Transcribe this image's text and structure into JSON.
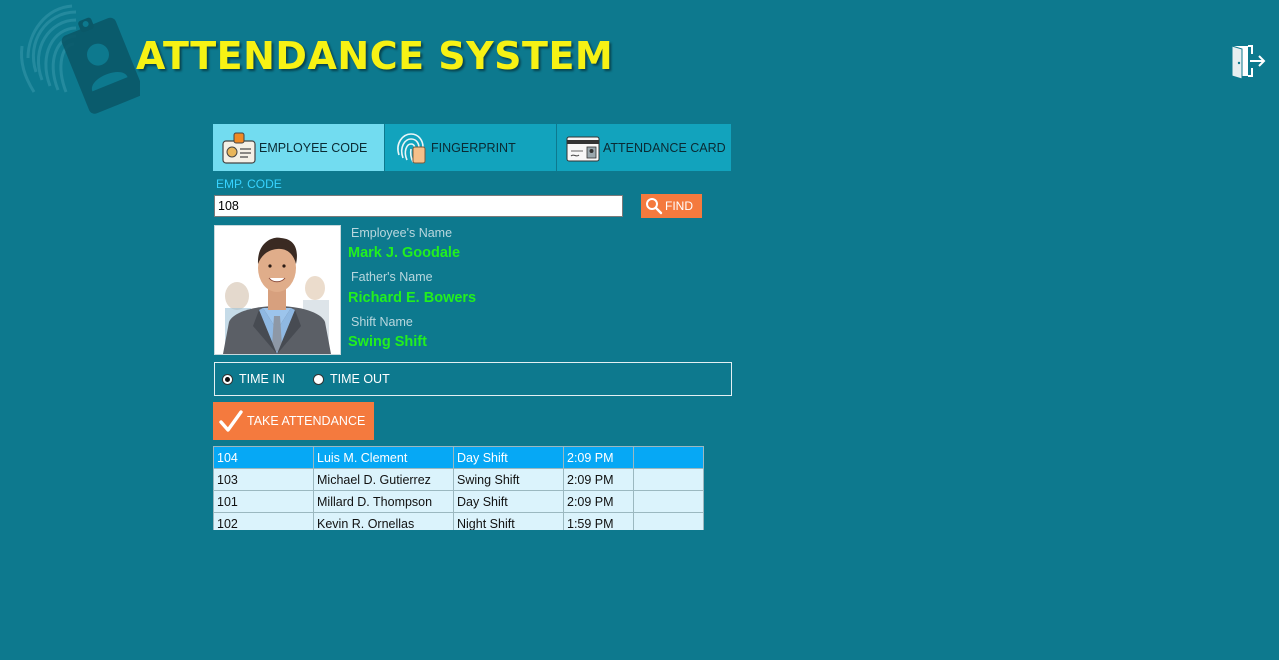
{
  "app": {
    "title": "ATTENDANCE SYSTEM"
  },
  "icons": {
    "logo": "fingerprint-id-badge-icon",
    "exit": "exit-door-icon",
    "find": "search-icon",
    "take": "checkmark-icon"
  },
  "colors": {
    "background": "#0d798e",
    "title": "#f7f214",
    "tab_active": "#72dcf0",
    "tab": "#12a3bd",
    "accent_button": "#f47a3e",
    "label_cyan": "#37d3ff",
    "value_green": "#22f01e",
    "row_selected": "#06a8f5",
    "row": "#dbf3fc"
  },
  "tabs": [
    {
      "label": "EMPLOYEE CODE",
      "icon": "id-badge-icon",
      "active": true
    },
    {
      "label": "FINGERPRINT",
      "icon": "fingerprint-icon",
      "active": false
    },
    {
      "label": "ATTENDANCE CARD",
      "icon": "attendance-card-icon",
      "active": false
    }
  ],
  "search": {
    "label": "EMP. CODE",
    "value": "108",
    "find_label": "FIND"
  },
  "employee": {
    "name_label": "Employee's Name",
    "name": "Mark J. Goodale",
    "father_label": "Father's Name",
    "father": "Richard E. Bowers",
    "shift_label": "Shift Name",
    "shift": "Swing Shift"
  },
  "time_mode": {
    "time_in_label": "TIME IN",
    "time_out_label": "TIME OUT",
    "selected": "TIME IN"
  },
  "take_attendance_label": "TAKE ATTENDANCE",
  "records": [
    {
      "code": "104",
      "name": "Luis M. Clement",
      "shift": "Day Shift",
      "time": "2:09 PM",
      "extra": "",
      "selected": true
    },
    {
      "code": "103",
      "name": "Michael D. Gutierrez",
      "shift": "Swing Shift",
      "time": "2:09 PM",
      "extra": "",
      "selected": false
    },
    {
      "code": "101",
      "name": "Millard D. Thompson",
      "shift": "Day Shift",
      "time": "2:09 PM",
      "extra": "",
      "selected": false
    },
    {
      "code": "102",
      "name": "Kevin R. Ornellas",
      "shift": "Night Shift",
      "time": "1:59 PM",
      "extra": "",
      "selected": false
    }
  ]
}
